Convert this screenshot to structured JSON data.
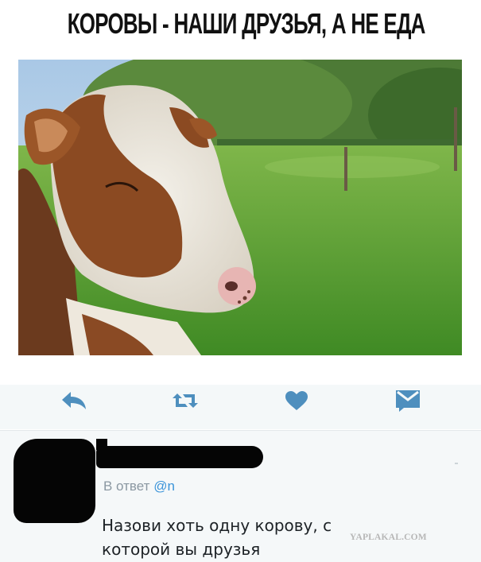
{
  "meme": {
    "title": "КОРОВЫ - НАШИ ДРУЗЬЯ, А НЕ ЕДА"
  },
  "tweet_actions": [
    {
      "icon": "reply-icon",
      "color": "#4e8fbe"
    },
    {
      "icon": "retweet-icon",
      "color": "#4e8fbe"
    },
    {
      "icon": "heart-icon",
      "color": "#4e8fbe"
    },
    {
      "icon": "direct-message-icon",
      "color": "#4e8fbe"
    }
  ],
  "reply": {
    "in_reply_to_label": "В ответ",
    "handle": "@n",
    "text_line1": "Назови хоть одну корову, с",
    "text_line2": "которой вы друзья"
  },
  "watermark": "YAPLAKAL.COM",
  "colors": {
    "accent": "#3b94d9",
    "action_icon": "#4e8fbe",
    "muted_text": "#8b98a2",
    "card_bg": "#f5f8f9"
  }
}
